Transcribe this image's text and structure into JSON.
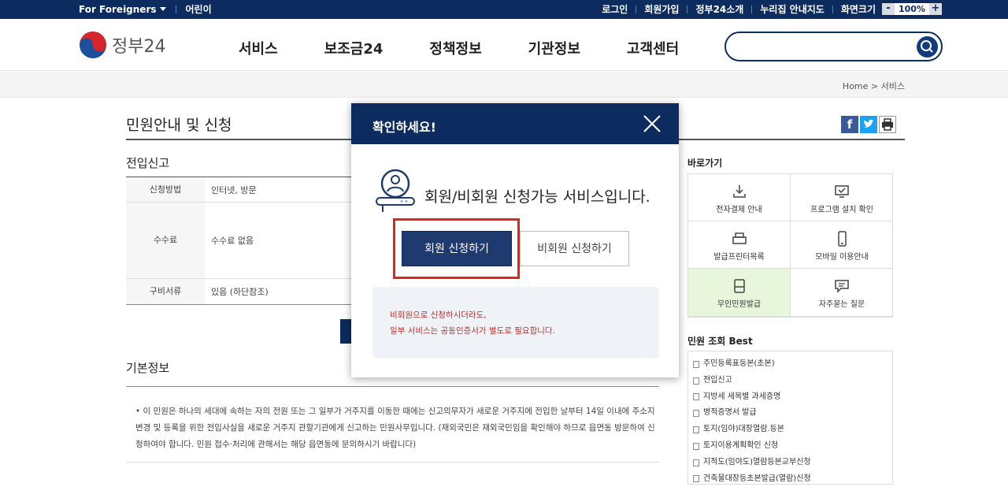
{
  "topbar": {
    "foreigners": "For Foreigners",
    "kids": "어린이",
    "login": "로그인",
    "signup": "회원가입",
    "about": "정부24소개",
    "sitemap": "누리집 안내지도",
    "screen_size": "화면크기",
    "zoom_minus": "-",
    "zoom_value": "100%",
    "zoom_plus": "+"
  },
  "header": {
    "logo_text": "정부24",
    "nav": [
      "서비스",
      "보조금24",
      "정책정보",
      "기관정보",
      "고객센터"
    ],
    "search_placeholder": ""
  },
  "breadcrumb": {
    "home": "Home",
    "sep": ">",
    "current": "서비스"
  },
  "page": {
    "title": "민원안내 및 신청",
    "section1": "전입신고",
    "table": [
      {
        "label": "신청방법",
        "value": "인터넷, 방문"
      },
      {
        "label": "수수료",
        "value": "수수료 없음"
      },
      {
        "label": "구비서류",
        "value": "있음 (하단참조)"
      }
    ],
    "section2": "기본정보",
    "paragraph": "•  이 민원은 하나의 세대에 속하는 자의 전원 또는 그 일부가 거주지를 이동한 때에는 신고의무자가 새로운 거주지에 전입한 날부터 14일 이내에 주소지변경 및 등록을 위한 전입사실을 새로운 거주지 관할기관에게 신고하는 민원사무입니다. (재외국민은 재외국민임을 확인해야 하므로 읍면동 방문하여 신청하여야 합니다. 민원 접수·처리에 관해서는 해당 읍면동에 문의하시기 바랍니다)"
  },
  "quicklinks": {
    "title": "바로가기",
    "items": [
      {
        "label": "전자결제 안내",
        "icon": "download-icon"
      },
      {
        "label": "프로그램 설치 확인",
        "icon": "monitor-icon"
      },
      {
        "label": "발급프린터목록",
        "icon": "printer-icon"
      },
      {
        "label": "모바일 이용안내",
        "icon": "mobile-icon"
      },
      {
        "label": "무인민원발급",
        "icon": "kiosk-icon"
      },
      {
        "label": "자주묻는 질문",
        "icon": "chat-icon"
      }
    ]
  },
  "best": {
    "title": "민원 조회 Best",
    "items": [
      "주민등록표등본(초본)",
      "전입신고",
      "지방세 세목별 과세증명",
      "병적증명서 발급",
      "토지(임야)대장열람.등본",
      "토지이용계획확인 신청",
      "지적도(임야도)열람등본교부신청",
      "건축물대장등초본발급(열람)신청"
    ]
  },
  "modal": {
    "title": "확인하세요!",
    "message": "회원/비회원 신청가능 서비스입니다.",
    "member_button": "회원 신청하기",
    "guest_button": "비회원 신청하기",
    "notice_line1": "비회원으로 신청하시더라도,",
    "notice_line2": "일부 서비스는 공동인증서가 별도로 필요합니다."
  },
  "colors": {
    "navy": "#0c2b5e",
    "highlight_red": "#e0261c",
    "notice_text": "#c0302b"
  }
}
